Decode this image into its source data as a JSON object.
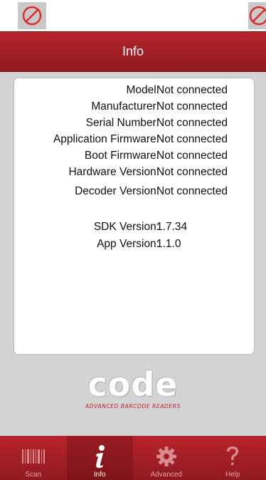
{
  "status_bar": {
    "left_icon": "no-connection-icon",
    "right_icon": "no-connection-icon"
  },
  "header": {
    "title": "Info"
  },
  "info": {
    "rows": [
      {
        "label": "Model:",
        "value": "Not connected"
      },
      {
        "label": "Manufacturer:",
        "value": "Not connected"
      },
      {
        "label": "Serial Number:",
        "value": "Not connected"
      },
      {
        "label": "Application Firmware:",
        "value": "Not connected"
      },
      {
        "label": "Boot Firmware:",
        "value": "Not connected"
      },
      {
        "label": "Hardware Version:",
        "value": "Not connected"
      },
      {
        "label": "Decoder Version:",
        "value": "Not connected"
      }
    ],
    "versions": [
      {
        "label": "SDK Version:",
        "value": "1.7.34"
      },
      {
        "label": "App Version:",
        "value": "1.1.0"
      }
    ]
  },
  "logo": {
    "word": "code",
    "tagline": "ADVANCED BARCODE READERS"
  },
  "tabs": [
    {
      "label": "Scan",
      "icon": "barcode-icon",
      "active": false
    },
    {
      "label": "Info",
      "icon": "info-icon",
      "active": true
    },
    {
      "label": "Advanced",
      "icon": "gear-icon",
      "active": false
    },
    {
      "label": "Help",
      "icon": "question-icon",
      "active": false
    }
  ],
  "colors": {
    "brand_red": "#b8232c",
    "background": "#d3d3d3",
    "card": "#ffffff"
  }
}
